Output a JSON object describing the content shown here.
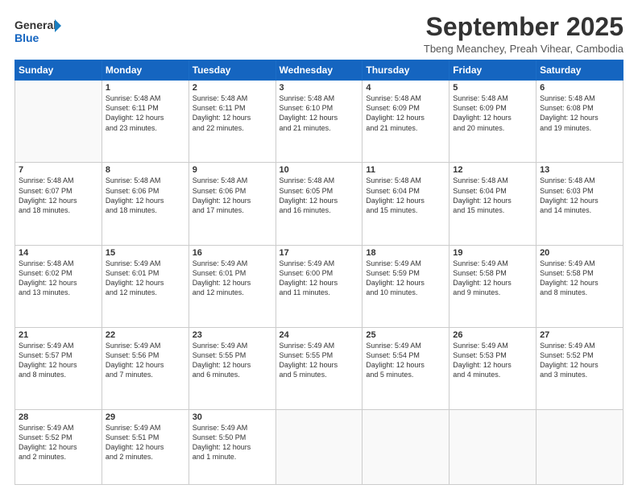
{
  "header": {
    "logo_line1": "General",
    "logo_line2": "Blue",
    "month_title": "September 2025",
    "subtitle": "Tbeng Meanchey, Preah Vihear, Cambodia"
  },
  "days_of_week": [
    "Sunday",
    "Monday",
    "Tuesday",
    "Wednesday",
    "Thursday",
    "Friday",
    "Saturday"
  ],
  "weeks": [
    [
      {
        "day": "",
        "info": ""
      },
      {
        "day": "1",
        "info": "Sunrise: 5:48 AM\nSunset: 6:11 PM\nDaylight: 12 hours\nand 23 minutes."
      },
      {
        "day": "2",
        "info": "Sunrise: 5:48 AM\nSunset: 6:11 PM\nDaylight: 12 hours\nand 22 minutes."
      },
      {
        "day": "3",
        "info": "Sunrise: 5:48 AM\nSunset: 6:10 PM\nDaylight: 12 hours\nand 21 minutes."
      },
      {
        "day": "4",
        "info": "Sunrise: 5:48 AM\nSunset: 6:09 PM\nDaylight: 12 hours\nand 21 minutes."
      },
      {
        "day": "5",
        "info": "Sunrise: 5:48 AM\nSunset: 6:09 PM\nDaylight: 12 hours\nand 20 minutes."
      },
      {
        "day": "6",
        "info": "Sunrise: 5:48 AM\nSunset: 6:08 PM\nDaylight: 12 hours\nand 19 minutes."
      }
    ],
    [
      {
        "day": "7",
        "info": "Sunrise: 5:48 AM\nSunset: 6:07 PM\nDaylight: 12 hours\nand 18 minutes."
      },
      {
        "day": "8",
        "info": "Sunrise: 5:48 AM\nSunset: 6:06 PM\nDaylight: 12 hours\nand 18 minutes."
      },
      {
        "day": "9",
        "info": "Sunrise: 5:48 AM\nSunset: 6:06 PM\nDaylight: 12 hours\nand 17 minutes."
      },
      {
        "day": "10",
        "info": "Sunrise: 5:48 AM\nSunset: 6:05 PM\nDaylight: 12 hours\nand 16 minutes."
      },
      {
        "day": "11",
        "info": "Sunrise: 5:48 AM\nSunset: 6:04 PM\nDaylight: 12 hours\nand 15 minutes."
      },
      {
        "day": "12",
        "info": "Sunrise: 5:48 AM\nSunset: 6:04 PM\nDaylight: 12 hours\nand 15 minutes."
      },
      {
        "day": "13",
        "info": "Sunrise: 5:48 AM\nSunset: 6:03 PM\nDaylight: 12 hours\nand 14 minutes."
      }
    ],
    [
      {
        "day": "14",
        "info": "Sunrise: 5:48 AM\nSunset: 6:02 PM\nDaylight: 12 hours\nand 13 minutes."
      },
      {
        "day": "15",
        "info": "Sunrise: 5:49 AM\nSunset: 6:01 PM\nDaylight: 12 hours\nand 12 minutes."
      },
      {
        "day": "16",
        "info": "Sunrise: 5:49 AM\nSunset: 6:01 PM\nDaylight: 12 hours\nand 12 minutes."
      },
      {
        "day": "17",
        "info": "Sunrise: 5:49 AM\nSunset: 6:00 PM\nDaylight: 12 hours\nand 11 minutes."
      },
      {
        "day": "18",
        "info": "Sunrise: 5:49 AM\nSunset: 5:59 PM\nDaylight: 12 hours\nand 10 minutes."
      },
      {
        "day": "19",
        "info": "Sunrise: 5:49 AM\nSunset: 5:58 PM\nDaylight: 12 hours\nand 9 minutes."
      },
      {
        "day": "20",
        "info": "Sunrise: 5:49 AM\nSunset: 5:58 PM\nDaylight: 12 hours\nand 8 minutes."
      }
    ],
    [
      {
        "day": "21",
        "info": "Sunrise: 5:49 AM\nSunset: 5:57 PM\nDaylight: 12 hours\nand 8 minutes."
      },
      {
        "day": "22",
        "info": "Sunrise: 5:49 AM\nSunset: 5:56 PM\nDaylight: 12 hours\nand 7 minutes."
      },
      {
        "day": "23",
        "info": "Sunrise: 5:49 AM\nSunset: 5:55 PM\nDaylight: 12 hours\nand 6 minutes."
      },
      {
        "day": "24",
        "info": "Sunrise: 5:49 AM\nSunset: 5:55 PM\nDaylight: 12 hours\nand 5 minutes."
      },
      {
        "day": "25",
        "info": "Sunrise: 5:49 AM\nSunset: 5:54 PM\nDaylight: 12 hours\nand 5 minutes."
      },
      {
        "day": "26",
        "info": "Sunrise: 5:49 AM\nSunset: 5:53 PM\nDaylight: 12 hours\nand 4 minutes."
      },
      {
        "day": "27",
        "info": "Sunrise: 5:49 AM\nSunset: 5:52 PM\nDaylight: 12 hours\nand 3 minutes."
      }
    ],
    [
      {
        "day": "28",
        "info": "Sunrise: 5:49 AM\nSunset: 5:52 PM\nDaylight: 12 hours\nand 2 minutes."
      },
      {
        "day": "29",
        "info": "Sunrise: 5:49 AM\nSunset: 5:51 PM\nDaylight: 12 hours\nand 2 minutes."
      },
      {
        "day": "30",
        "info": "Sunrise: 5:49 AM\nSunset: 5:50 PM\nDaylight: 12 hours\nand 1 minute."
      },
      {
        "day": "",
        "info": ""
      },
      {
        "day": "",
        "info": ""
      },
      {
        "day": "",
        "info": ""
      },
      {
        "day": "",
        "info": ""
      }
    ]
  ]
}
